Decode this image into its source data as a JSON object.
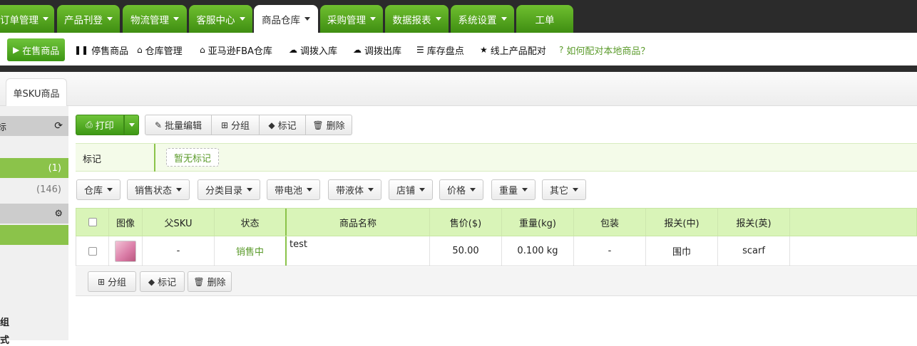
{
  "topnav": {
    "tabs": [
      {
        "label": "订单管理",
        "caret": true
      },
      {
        "label": "产品刊登",
        "caret": true
      },
      {
        "label": "物流管理",
        "caret": true
      },
      {
        "label": "客服中心",
        "caret": true
      },
      {
        "label": "商品仓库",
        "caret": true,
        "active": true
      },
      {
        "label": "采购管理",
        "caret": true
      },
      {
        "label": "数据报表",
        "caret": true
      },
      {
        "label": "系统设置",
        "caret": true
      },
      {
        "label": "工单",
        "caret": false
      }
    ]
  },
  "subnav": {
    "items": [
      {
        "label": "在售商品",
        "icon": "play-icon"
      },
      {
        "label": "停售商品",
        "icon": "pause-icon"
      },
      {
        "label": "仓库管理",
        "icon": "home-icon"
      },
      {
        "label": "亚马逊FBA仓库",
        "icon": "home-icon"
      },
      {
        "label": "调拨入库",
        "icon": "cloud-icon"
      },
      {
        "label": "调拨出库",
        "icon": "cloud-icon"
      },
      {
        "label": "库存盘点",
        "icon": "list-icon"
      },
      {
        "label": "线上产品配对",
        "icon": "star-icon"
      }
    ],
    "help": "如何配对本地商品？"
  },
  "page_tab": "单SKU商品",
  "sidebar": {
    "head1": "标",
    "row1_count": "(1)",
    "row2_count": "(146)",
    "text1": "组",
    "text2": "式"
  },
  "toolbar": {
    "print": "打印",
    "batch_edit": "批量编辑",
    "group": "分组",
    "tag": "标记",
    "delete": "删除"
  },
  "tagbar": {
    "label": "标记",
    "none": "暂无标记"
  },
  "filters": [
    "仓库",
    "销售状态",
    "分类目录",
    "带电池",
    "带液体",
    "店铺",
    "价格",
    "重量",
    "其它"
  ],
  "table": {
    "columns": [
      "图像",
      "父SKU",
      "状态",
      "商品名称",
      "售价($)",
      "重量(kg)",
      "包装",
      "报关(中)",
      "报关(英)"
    ],
    "rows": [
      {
        "parent_sku": "-",
        "status": "销售中",
        "name": "test",
        "price": "50.00",
        "weight": "0.100 kg",
        "package": "-",
        "customs_cn": "围巾",
        "customs_en": "scarf"
      }
    ]
  },
  "bottom": {
    "group": "分组",
    "tag": "标记",
    "delete": "删除"
  }
}
